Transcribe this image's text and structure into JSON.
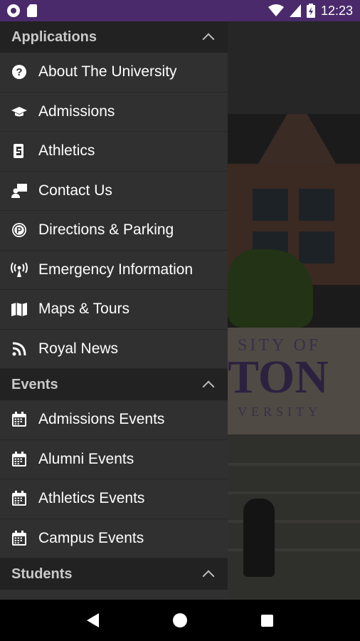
{
  "status_bar": {
    "time": "12:23",
    "icons": [
      "notification-circle-icon",
      "sd-card-icon",
      "wifi-icon",
      "cell-signal-icon",
      "battery-icon"
    ],
    "color": "#4a2a6b"
  },
  "background": {
    "banner_line1": "SITY OF",
    "banner_line2": "TON",
    "banner_line3": "VERSITY"
  },
  "drawer": {
    "sections": [
      {
        "title": "Applications",
        "expanded": true,
        "items": [
          {
            "label": "About The University",
            "icon": "question-circle-icon"
          },
          {
            "label": "Admissions",
            "icon": "graduation-cap-icon"
          },
          {
            "label": "Athletics",
            "icon": "athletics-icon"
          },
          {
            "label": "Contact Us",
            "icon": "contact-icon"
          },
          {
            "label": "Directions & Parking",
            "icon": "parking-icon"
          },
          {
            "label": "Emergency Information",
            "icon": "broadcast-icon"
          },
          {
            "label": "Maps & Tours",
            "icon": "map-icon"
          },
          {
            "label": "Royal News",
            "icon": "rss-icon"
          }
        ]
      },
      {
        "title": "Events",
        "expanded": true,
        "items": [
          {
            "label": "Admissions Events",
            "icon": "calendar-icon"
          },
          {
            "label": "Alumni Events",
            "icon": "calendar-icon"
          },
          {
            "label": "Athletics Events",
            "icon": "calendar-icon"
          },
          {
            "label": "Campus Events",
            "icon": "calendar-icon"
          }
        ]
      },
      {
        "title": "Students",
        "expanded": true,
        "items": []
      }
    ]
  },
  "nav_bar": {
    "buttons": [
      "back-icon",
      "home-icon",
      "recent-apps-icon"
    ]
  }
}
